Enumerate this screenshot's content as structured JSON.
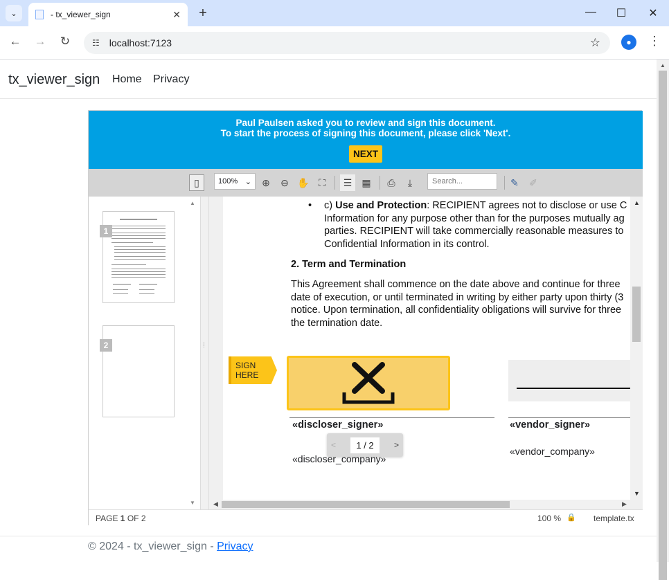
{
  "browser": {
    "tab_title": "- tx_viewer_sign",
    "url": "localhost:7123"
  },
  "site": {
    "brand": "tx_viewer_sign",
    "nav": [
      "Home",
      "Privacy"
    ],
    "footer_text": "© 2024 - tx_viewer_sign - ",
    "footer_link": "Privacy"
  },
  "banner": {
    "line1": "Paul Paulsen asked you to review and sign this document.",
    "line2": "To start the process of signing this document, please click 'Next'.",
    "next_label": "NEXT"
  },
  "viewer_toolbar": {
    "zoom": "100%",
    "search_placeholder": "Search..."
  },
  "thumbnails": [
    "1",
    "2"
  ],
  "document": {
    "item_c_label": "c) ",
    "item_c_bold": "Use and Protection",
    "item_c_line1": ": RECIPIENT agrees not to disclose or use C",
    "item_c_line2": "Information for any purpose other than for the purposes mutually ag",
    "item_c_line3": "parties. RECIPIENT will take commercially reasonable measures to",
    "item_c_line4": "Confidential Information in its control.",
    "section_heading": "2. Term and Termination",
    "para_line1": "This Agreement shall commence on the date above and continue for three",
    "para_line2": "date of execution, or until terminated in writing by either party upon thirty (3",
    "para_line3": "notice. Upon termination, all confidentiality obligations will survive for three",
    "para_line4": "the termination date.",
    "sign_here": "SIGN HERE",
    "discloser_signer": "«discloser_signer»",
    "discloser_company": "«discloser_company»",
    "vendor_signer": "«vendor_signer»",
    "vendor_company": "«vendor_company»"
  },
  "pager": {
    "current": "1",
    "total": "2"
  },
  "status": {
    "page_prefix": "PAGE ",
    "page_current": "1",
    "page_suffix": " OF 2",
    "zoom": "100 %",
    "filename": "template.tx"
  }
}
